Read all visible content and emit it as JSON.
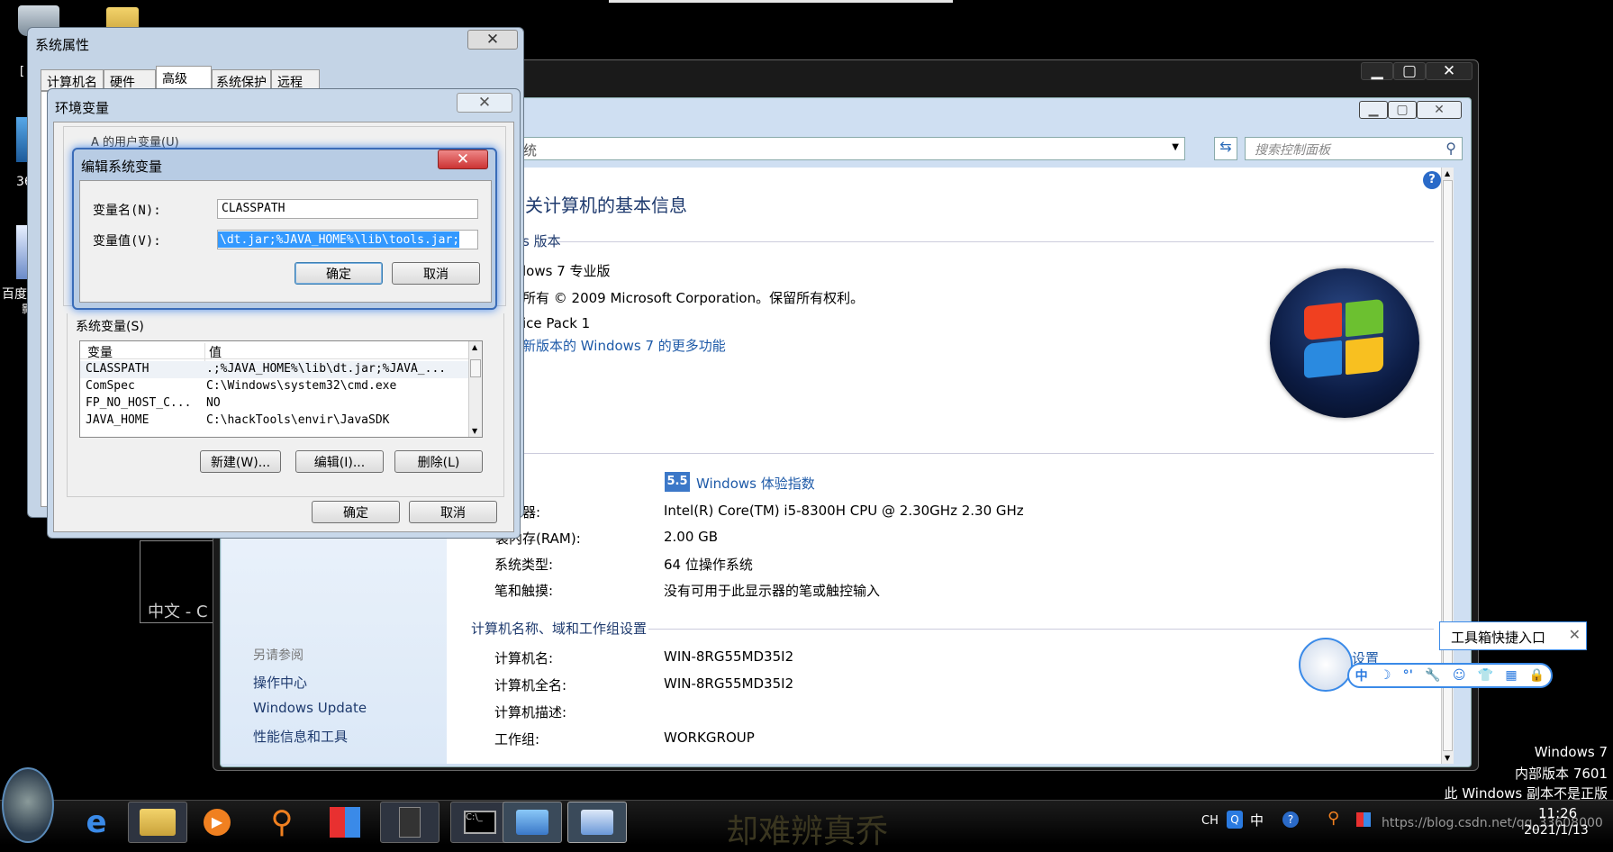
{
  "desktop": {
    "top_partial": "",
    "left_label_1": "36",
    "left_label_2": "百度",
    "left_label_3": "影",
    "left_label_4": "[",
    "ime_window": "中文 - C",
    "watermark": "却难辨真乔"
  },
  "os_info": {
    "line1": "Windows 7",
    "line2": "内部版本 7601",
    "line3": "此 Windows 副本不是正版"
  },
  "control_panel": {
    "breadcrumb": "统",
    "search_placeholder": "搜索控制面板",
    "heading": "关计算机的基本信息",
    "edition_section": "s 版本",
    "edition": "lows 7 专业版",
    "copyright": "所有 © 2009 Microsoft Corporation。保留所有权利。",
    "service_pack": "ice Pack 1",
    "more_features_link": "新版本的 Windows 7 的更多功能",
    "rating_badge": "5.5",
    "rating_link": "Windows 体验指数",
    "rows": [
      {
        "label": "器:",
        "value": "Intel(R) Core(TM) i5-8300H CPU @ 2.30GHz   2.30 GHz"
      },
      {
        "label": "装内存(RAM):",
        "value": "2.00 GB"
      },
      {
        "label": "系统类型:",
        "value": "64 位操作系统"
      },
      {
        "label": "笔和触摸:",
        "value": "没有可用于此显示器的笔或触控输入"
      }
    ],
    "computer_section": "计算机名称、域和工作组设置",
    "computer_rows": [
      {
        "label": "计算机名:",
        "value": "WIN-8RG55MD35I2"
      },
      {
        "label": "计算机全名:",
        "value": "WIN-8RG55MD35I2"
      },
      {
        "label": "计算机描述:",
        "value": ""
      },
      {
        "label": "工作组:",
        "value": "WORKGROUP"
      }
    ],
    "change_settings": "设置",
    "see_also": "另请参阅",
    "see_also_links": [
      "操作中心",
      "Windows Update",
      "性能信息和工具"
    ]
  },
  "sys_props": {
    "title": "系统属性",
    "tabs": [
      "计算机名",
      "硬件",
      "高级",
      "系统保护",
      "远程"
    ]
  },
  "env_vars": {
    "title": "环境变量",
    "user_vars_label": "A 的用户变量(U)",
    "sys_vars_label": "系统变量(S)",
    "col_var": "变量",
    "col_val": "值",
    "rows": [
      {
        "name": "CLASSPATH",
        "value": ".;%JAVA_HOME%\\lib\\dt.jar;%JAVA_..."
      },
      {
        "name": "ComSpec",
        "value": "C:\\Windows\\system32\\cmd.exe"
      },
      {
        "name": "FP_NO_HOST_C...",
        "value": "NO"
      },
      {
        "name": "JAVA_HOME",
        "value": "C:\\hackTools\\envir\\JavaSDK"
      }
    ],
    "new_btn": "新建(W)...",
    "edit_btn": "编辑(I)...",
    "delete_btn": "删除(L)",
    "ok_btn": "确定",
    "cancel_btn": "取消"
  },
  "edit_var": {
    "title": "编辑系统变量",
    "name_label": "变量名(N):",
    "name_value": "CLASSPATH",
    "value_label": "变量值(V):",
    "value_value": "\\dt.jar;%JAVA_HOME%\\lib\\tools.jar;",
    "ok_btn": "确定",
    "cancel_btn": "取消"
  },
  "toolbox": {
    "title": "工具箱快捷入口",
    "icons": [
      "中",
      "☽",
      "°'",
      "🔧",
      "☺",
      "👕",
      "▦",
      "🔒"
    ]
  },
  "taskbar": {
    "lang": "CH",
    "ime": "中",
    "time": "11:26",
    "date": "2021/1/13",
    "url_watermark": "https://blog.csdn.net/qq_33608000"
  }
}
